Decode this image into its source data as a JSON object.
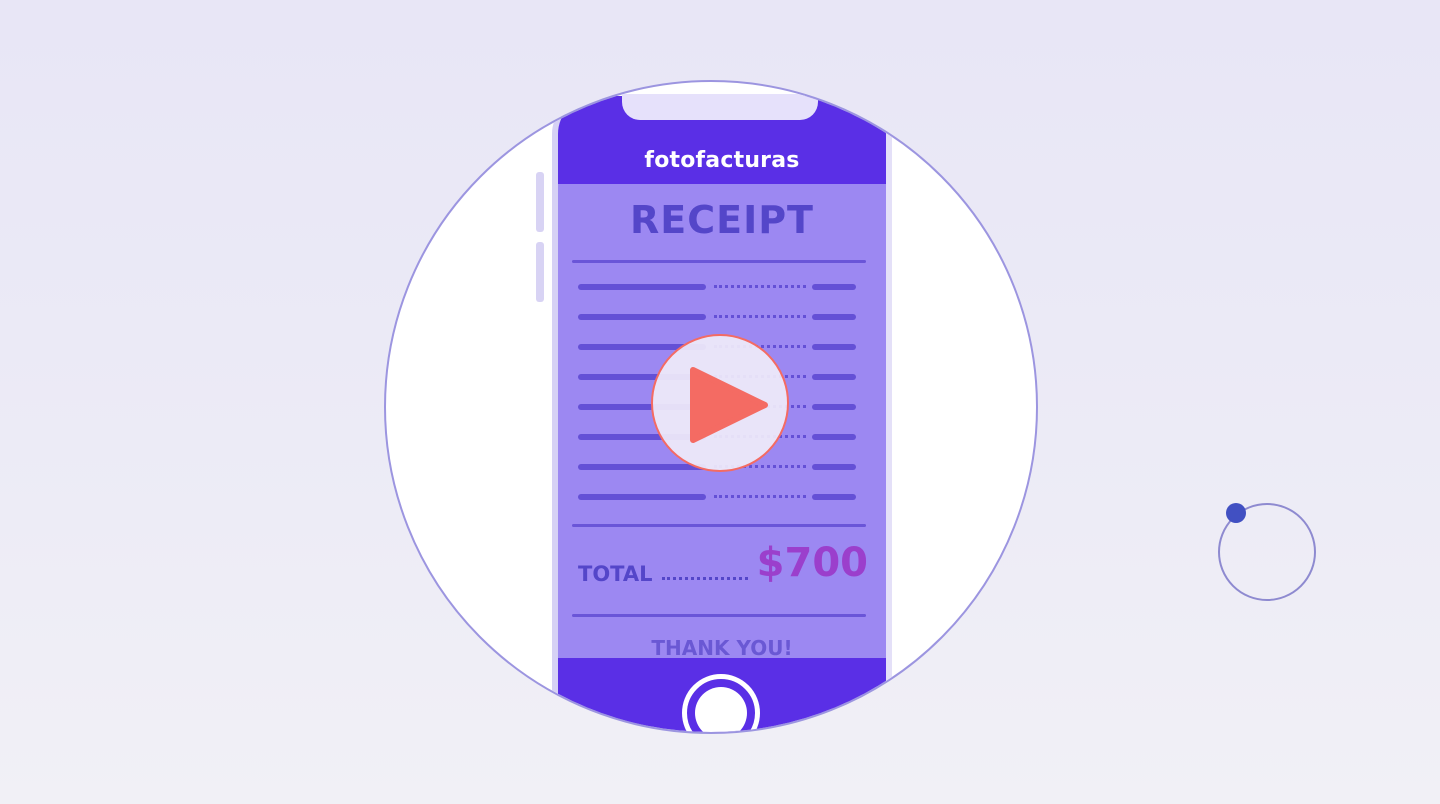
{
  "brand": {
    "name": "fotofacturas",
    "color": "#5a2fe6"
  },
  "receipt": {
    "title": "RECEIPT",
    "line_items_count": 8,
    "total_label": "TOTAL",
    "total_amount": "$700",
    "thanks": "THANK YOU!"
  },
  "video": {
    "play_icon": "play-icon",
    "accent_color": "#f46b63"
  },
  "decor": {
    "orbit_icon": "orbit-circle-icon",
    "dot_color": "#4150c2"
  }
}
